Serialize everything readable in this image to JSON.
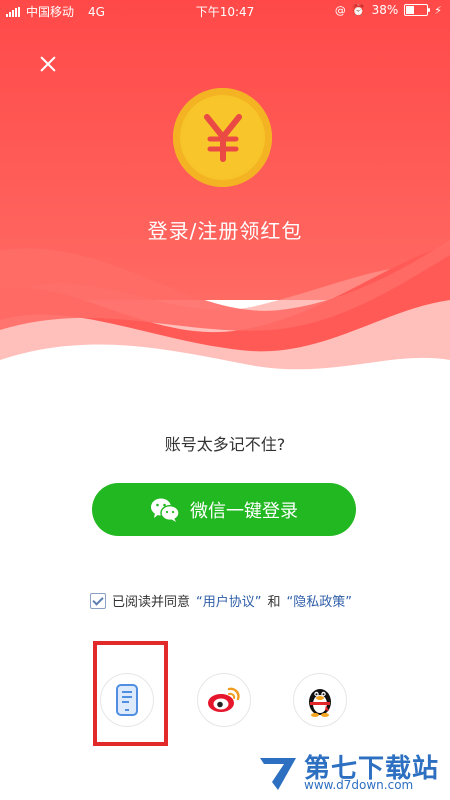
{
  "status_bar": {
    "carrier": "中国移动",
    "network": "4G",
    "time": "下午10:47",
    "battery_percent": "38%",
    "battery_level": 0.38
  },
  "hero": {
    "title": "登录/注册领红包",
    "colors": {
      "top": "#ff4d4d",
      "bottom": "#ff6b63"
    }
  },
  "prompt": {
    "text": "账号太多记不住?"
  },
  "wechat_login": {
    "label": "微信一键登录",
    "color": "#22b821"
  },
  "agreement": {
    "prefix": "已阅读并同意",
    "terms": "“用户协议”",
    "and": "和",
    "privacy": "“隐私政策”",
    "checked": true
  },
  "alt_login": [
    {
      "name": "phone-login",
      "icon": "phone-icon"
    },
    {
      "name": "weibo-login",
      "icon": "weibo-icon"
    },
    {
      "name": "qq-login",
      "icon": "qq-penguin-icon"
    }
  ],
  "watermark": {
    "name": "第七下载站",
    "url": "www.d7down.com"
  }
}
